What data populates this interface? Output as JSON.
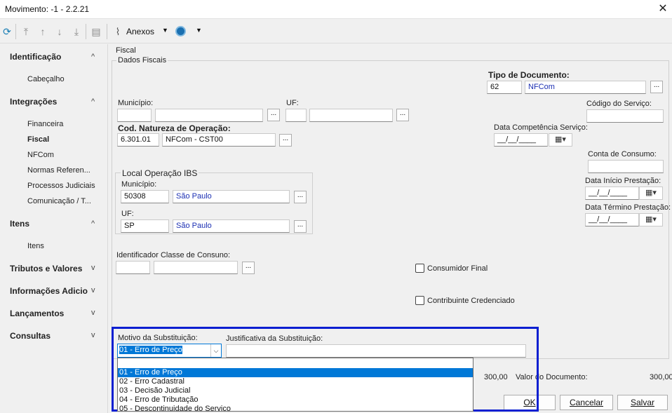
{
  "window": {
    "title": "Movimento: -1 - 2.2.21",
    "close_glyph": "✕"
  },
  "toolbar": {
    "anexos_label": "Anexos"
  },
  "sidebar": {
    "sections": [
      {
        "label": "Identificação",
        "chevron": "^"
      },
      {
        "label": "Integrações",
        "chevron": "^"
      },
      {
        "label": "Itens",
        "chevron": "^"
      },
      {
        "label": "Tributos e Valores",
        "chevron": "v"
      },
      {
        "label": "Informações Adicio",
        "chevron": "v"
      },
      {
        "label": "Lançamentos",
        "chevron": "v"
      },
      {
        "label": "Consultas",
        "chevron": "v"
      }
    ],
    "items": [
      "Cabeçalho",
      "Financeira",
      "Fiscal",
      "NFCom",
      "Normas Referen...",
      "Processos Judiciais",
      "Comunicação / T...",
      "Itens"
    ]
  },
  "form": {
    "fiscal_label": "Fiscal",
    "dados_fiscais_label": "Dados Fiscais",
    "tipo_documento_label": "Tipo de Documento:",
    "tipo_documento_code": "62",
    "tipo_documento_name": "NFCom",
    "municipio_label": "Município:",
    "uf_label": "UF:",
    "codigo_servico_label": "Código do Serviço:",
    "natureza_label": "Cod. Natureza de Operação:",
    "natureza_code": "6.301.01",
    "natureza_name": "NFCom - CST00",
    "data_competencia_label": "Data Competência Serviço:",
    "date_mask": "__/__/____",
    "conta_consumo_label": "Conta de Consumo:",
    "local_ibs_label": "Local Operação IBS",
    "ibs_municipio_label": "Município:",
    "ibs_municipio_code": "50308",
    "ibs_municipio_name": "São Paulo",
    "ibs_uf_label": "UF:",
    "ibs_uf_code": "SP",
    "ibs_uf_name": "São Paulo",
    "data_inicio_label": "Data Início Prestação:",
    "data_termino_label": "Data Término Prestação:",
    "identificador_label": "Identificador Classe de Consuno:",
    "consumidor_final_label": "Consumidor Final",
    "contribuinte_label": "Contribuinte Credenciado",
    "motivo_label": "Motivo da Substituição:",
    "motivo_value": "01 - Erro de Preço",
    "justificativa_label": "Justificativa da Substituição:",
    "motivo_options": [
      "01 - Erro de Preço",
      "02 - Erro Cadastral",
      "03 - Decisão Judicial",
      "04 - Erro de Tributação",
      "05 - Descontinuidade do Serviço"
    ],
    "dots": "...",
    "total_value": "300,00",
    "valor_documento_label": "Valor do Documento:",
    "valor_documento_value": "300,00"
  },
  "buttons": {
    "ok": "OK",
    "cancel": "Cancelar",
    "save": "Salvar"
  },
  "colors": {
    "highlight_border": "#0a1fd1",
    "selection": "#0078d7",
    "link_text": "#1b2fb3"
  }
}
